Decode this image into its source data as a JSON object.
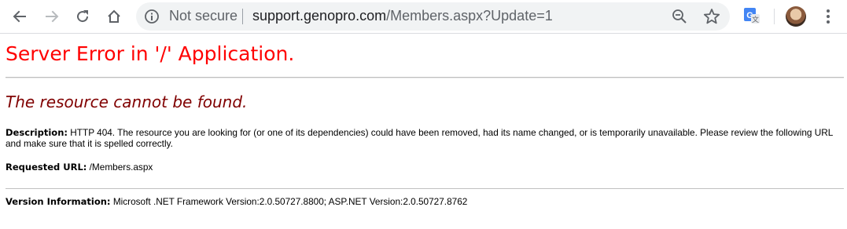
{
  "browser": {
    "security_label": "Not secure",
    "url_host": "support.genopro.com",
    "url_path": "/Members.aspx?Update=1",
    "icons": {
      "back": "back-arrow-icon",
      "forward": "forward-arrow-icon",
      "reload": "reload-icon",
      "home": "home-icon",
      "info": "info-icon",
      "zoom": "zoom-out-icon",
      "bookmark": "star-icon",
      "extension": "google-translate-icon",
      "profile": "avatar",
      "menu": "kebab-menu-icon"
    }
  },
  "page": {
    "title": "Server Error in '/' Application.",
    "subtitle": "The resource cannot be found.",
    "description_label": "Description:",
    "description_text": "HTTP 404. The resource you are looking for (or one of its dependencies) could have been removed, had its name changed, or is temporarily unavailable.  Please review the following URL and make sure that it is spelled correctly.",
    "requested_url_label": "Requested URL:",
    "requested_url_value": "/Members.aspx",
    "version_label": "Version Information:",
    "version_value": "Microsoft .NET Framework Version:2.0.50727.8800; ASP.NET Version:2.0.50727.8762"
  },
  "colors": {
    "title": "#ff0000",
    "subtitle": "#800000",
    "omnibox": "#f1f3f4",
    "icon": "#5f6368"
  }
}
